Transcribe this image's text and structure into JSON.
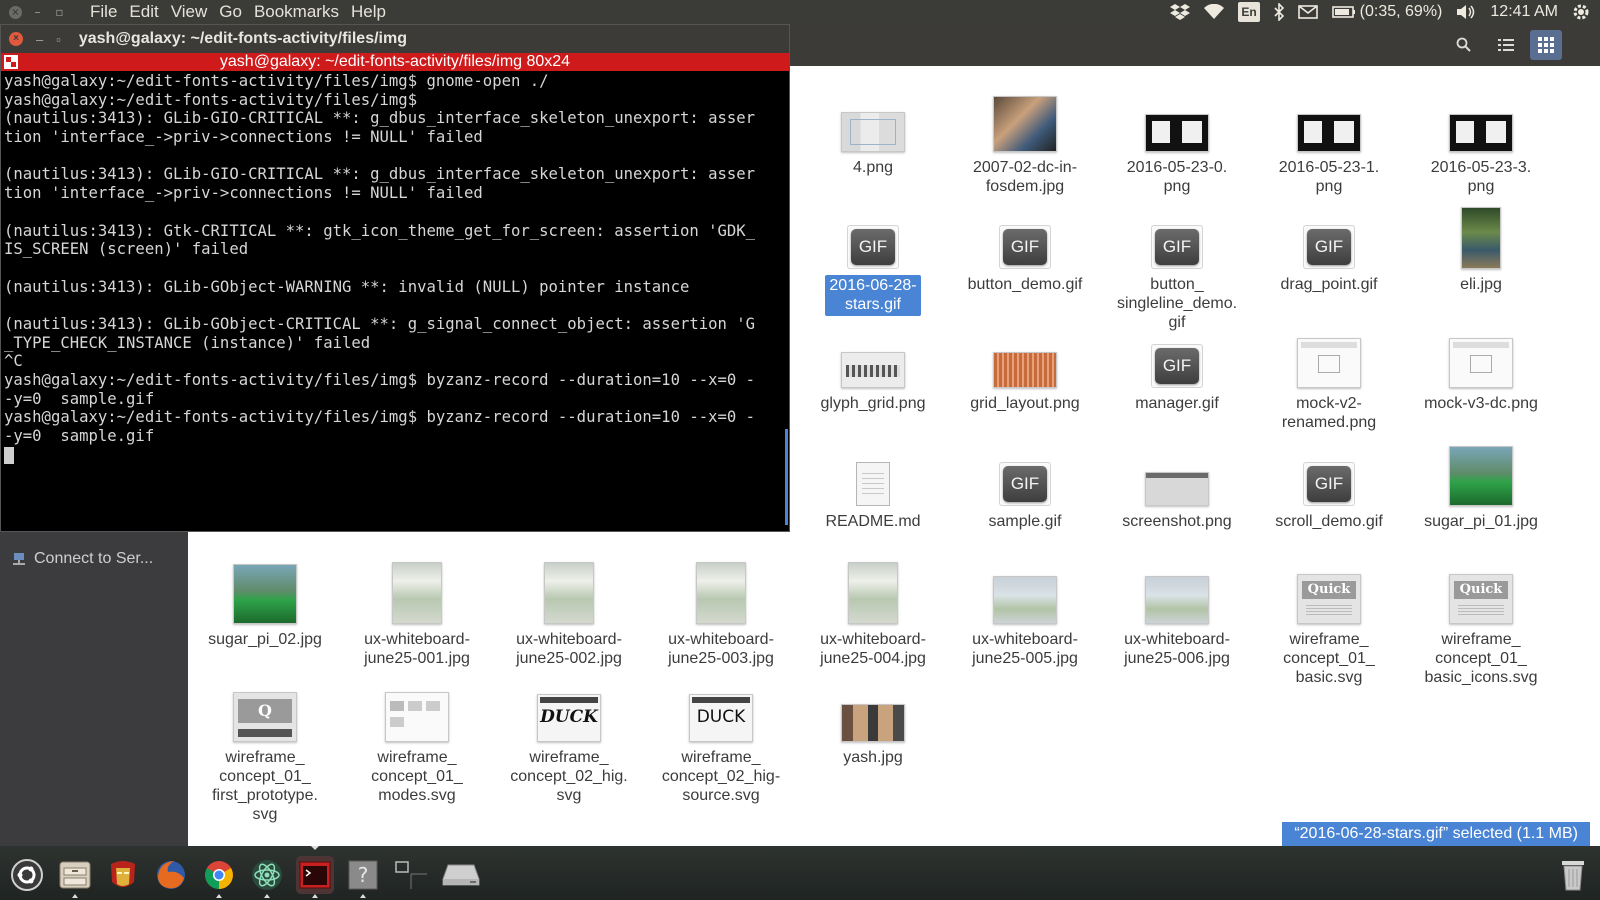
{
  "top_panel": {
    "menu": [
      "File",
      "Edit",
      "View",
      "Go",
      "Bookmarks",
      "Help"
    ],
    "keyboard_layout": "En",
    "battery": "(0:35, 69%)",
    "clock": "12:41 AM"
  },
  "terminal": {
    "window_title": "yash@galaxy: ~/edit-fonts-activity/files/img",
    "tab_title": "yash@galaxy: ~/edit-fonts-activity/files/img 80x24",
    "lines": [
      "yash@galaxy:~/edit-fonts-activity/files/img$ gnome-open ./",
      "yash@galaxy:~/edit-fonts-activity/files/img$",
      "(nautilus:3413): GLib-GIO-CRITICAL **: g_dbus_interface_skeleton_unexport: asser",
      "tion 'interface_->priv->connections != NULL' failed",
      "",
      "(nautilus:3413): GLib-GIO-CRITICAL **: g_dbus_interface_skeleton_unexport: asser",
      "tion 'interface_->priv->connections != NULL' failed",
      "",
      "(nautilus:3413): Gtk-CRITICAL **: gtk_icon_theme_get_for_screen: assertion 'GDK_",
      "IS_SCREEN (screen)' failed",
      "",
      "(nautilus:3413): GLib-GObject-WARNING **: invalid (NULL) pointer instance",
      "",
      "(nautilus:3413): GLib-GObject-CRITICAL **: g_signal_connect_object: assertion 'G",
      "_TYPE_CHECK_INSTANCE (instance)' failed",
      "^C",
      "yash@galaxy:~/edit-fonts-activity/files/img$ byzanz-record --duration=10 --x=0 -",
      "-y=0  sample.gif",
      "yash@galaxy:~/edit-fonts-activity/files/img$ byzanz-record --duration=10 --x=0 -",
      "-y=0  sample.gif"
    ]
  },
  "nautilus": {
    "sidebar": {
      "connect_label": "Connect to Ser..."
    },
    "status": "“2016-06-28-stars.gif” selected (1.1 MB)",
    "files": [
      {
        "name": "4.png",
        "kind": "png-grid"
      },
      {
        "name": "2007-02-dc-in-\nfosdem.jpg",
        "kind": "photo"
      },
      {
        "name": "2016-05-23-0.\npng",
        "kind": "png-dark"
      },
      {
        "name": "2016-05-23-1.\npng",
        "kind": "png-dark"
      },
      {
        "name": "2016-05-23-3.\npng",
        "kind": "png-dark"
      },
      {
        "name": "2016-06-28-\nstars.gif",
        "kind": "gif",
        "selected": true
      },
      {
        "name": "button_demo.gif",
        "kind": "gif"
      },
      {
        "name": "button_\nsingleline_demo.\ngif",
        "kind": "gif"
      },
      {
        "name": "drag_point.gif",
        "kind": "gif"
      },
      {
        "name": "eli.jpg",
        "kind": "photo-tall"
      },
      {
        "name": "glyph_grid.png",
        "kind": "png-light"
      },
      {
        "name": "grid_layout.png",
        "kind": "png-orange"
      },
      {
        "name": "manager.gif",
        "kind": "gif"
      },
      {
        "name": "mock-v2-\nrenamed.png",
        "kind": "png-mock"
      },
      {
        "name": "mock-v3-dc.png",
        "kind": "png-mock"
      },
      {
        "name": "README.md",
        "kind": "doc"
      },
      {
        "name": "sample.gif",
        "kind": "gif"
      },
      {
        "name": "screenshot.png",
        "kind": "png-gray"
      },
      {
        "name": "scroll_demo.gif",
        "kind": "gif"
      },
      {
        "name": "sugar_pi_01.jpg",
        "kind": "photo-green"
      },
      {
        "name": "sugar_pi_02.jpg",
        "kind": "photo-green"
      },
      {
        "name": "ux-whiteboard-\njune25-001.jpg",
        "kind": "whiteboard"
      },
      {
        "name": "ux-whiteboard-\njune25-002.jpg",
        "kind": "whiteboard"
      },
      {
        "name": "ux-whiteboard-\njune25-003.jpg",
        "kind": "whiteboard"
      },
      {
        "name": "ux-whiteboard-\njune25-004.jpg",
        "kind": "whiteboard"
      },
      {
        "name": "ux-whiteboard-\njune25-005.jpg",
        "kind": "whiteboard-wide"
      },
      {
        "name": "ux-whiteboard-\njune25-006.jpg",
        "kind": "whiteboard-wide"
      },
      {
        "name": "wireframe_\nconcept_01_\nbasic.svg",
        "kind": "svg-quick",
        "thumb_text": "Quick"
      },
      {
        "name": "wireframe_\nconcept_01_\nbasic_icons.svg",
        "kind": "svg-quick",
        "thumb_text": "Quick"
      },
      {
        "name": "wireframe_\nconcept_01_\nfirst_prototype.\nsvg",
        "kind": "svg-q",
        "thumb_text": "Q"
      },
      {
        "name": "wireframe_\nconcept_01_\nmodes.svg",
        "kind": "svg-modes"
      },
      {
        "name": "wireframe_\nconcept_02_hig.\nsvg",
        "kind": "svg-duck",
        "thumb_text": "DUCK"
      },
      {
        "name": "wireframe_\nconcept_02_hig-\nsource.svg",
        "kind": "svg-duck-plain",
        "thumb_text": "DUCK"
      },
      {
        "name": "yash.jpg",
        "kind": "photo-faces"
      }
    ]
  },
  "launcher": {
    "items": [
      "dash-home",
      "files",
      "iron-man",
      "firefox",
      "chrome",
      "atom",
      "terminal",
      "help",
      "workspaces",
      "drive"
    ]
  }
}
